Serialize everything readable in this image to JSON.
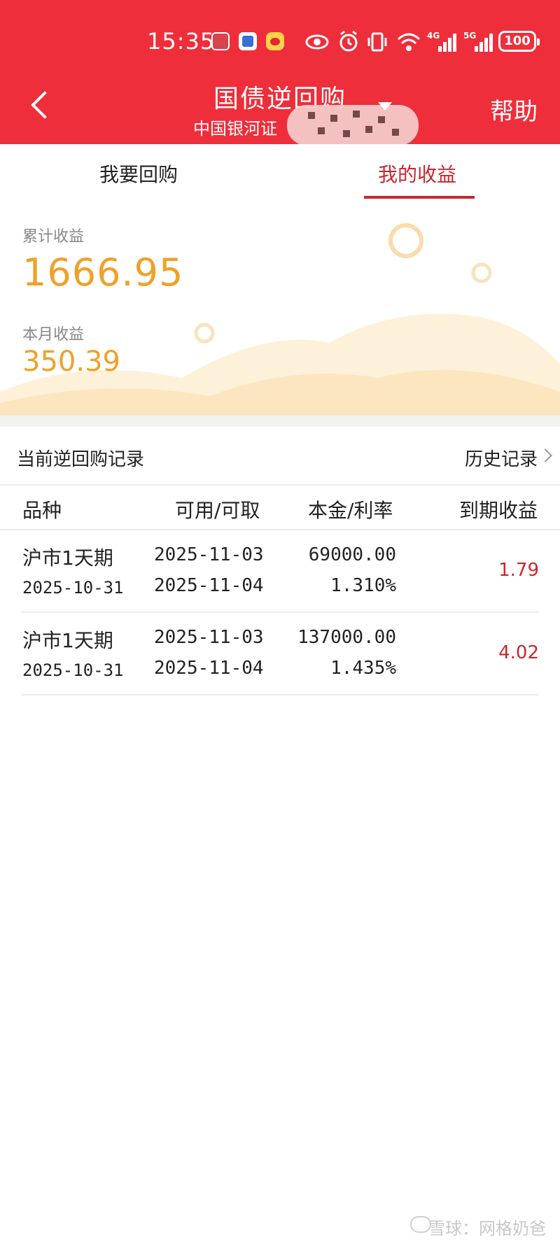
{
  "status_bar": {
    "time": "15:35",
    "signal_labels": [
      "4G",
      "5G"
    ],
    "battery": "100",
    "icons": [
      "huawei-app-icon",
      "app-icon",
      "weibo-icon",
      "eye-icon",
      "alarm-icon",
      "vibrate-icon",
      "wifi-icon"
    ]
  },
  "header": {
    "title": "国债逆回购",
    "subtitle": "中国银河证",
    "help": "帮助",
    "accent_color": "#ee2e3a"
  },
  "tabs": [
    {
      "label": "我要回购",
      "active": false
    },
    {
      "label": "我的收益",
      "active": true
    }
  ],
  "earnings": {
    "cumulative_label": "累计收益",
    "cumulative_value": "1666.95",
    "monthly_label": "本月收益",
    "monthly_value": "350.39",
    "value_color": "#f0a129"
  },
  "records": {
    "title": "当前逆回购记录",
    "history_link": "历史记录",
    "columns": [
      "品种",
      "可用/可取",
      "本金/利率",
      "到期收益"
    ],
    "rows": [
      {
        "name": "沪市1天期",
        "date": "2025-10-31",
        "available": "2025-11-03",
        "withdrawable": "2025-11-04",
        "principal": "69000.00",
        "rate": "1.310%",
        "yield": "1.79"
      },
      {
        "name": "沪市1天期",
        "date": "2025-10-31",
        "available": "2025-11-03",
        "withdrawable": "2025-11-04",
        "principal": "137000.00",
        "rate": "1.435%",
        "yield": "4.02"
      }
    ],
    "yield_color": "#c8282f"
  },
  "watermark": "雪球：网格奶爸"
}
